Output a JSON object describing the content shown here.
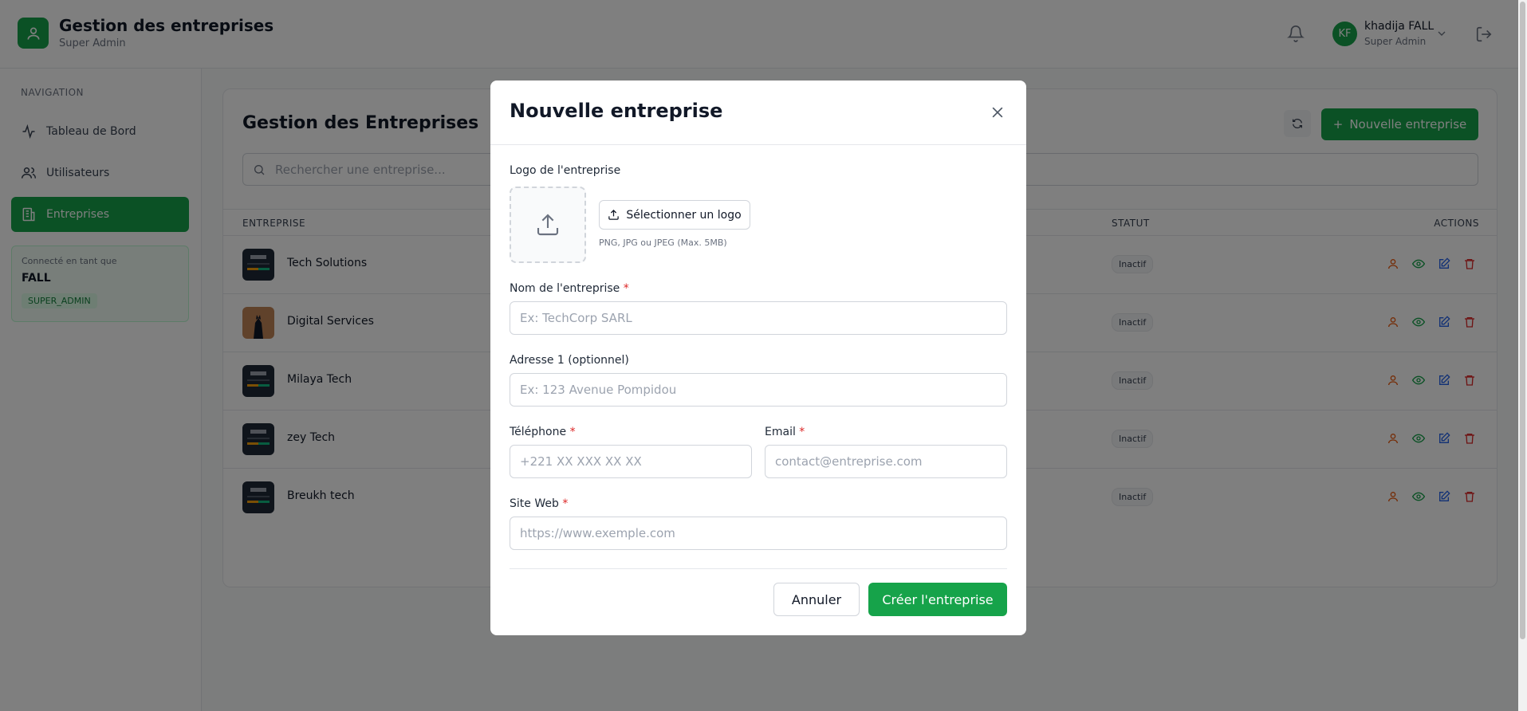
{
  "header": {
    "app_title": "Gestion des entreprises",
    "app_subtitle": "Super Admin",
    "user_initials": "KF",
    "user_name": "khadija FALL",
    "user_role": "Super Admin"
  },
  "sidebar": {
    "heading": "NAVIGATION",
    "items": [
      {
        "label": "Tableau de Bord",
        "icon": "activity-icon",
        "active": false
      },
      {
        "label": "Utilisateurs",
        "icon": "users-icon",
        "active": false
      },
      {
        "label": "Entreprises",
        "icon": "building-icon",
        "active": true
      }
    ],
    "connected_label": "Connecté en tant que",
    "connected_name": "FALL",
    "connected_badge": "SUPER_ADMIN"
  },
  "main": {
    "title": "Gestion des Entreprises",
    "new_button_label": "Nouvelle entreprise",
    "search_placeholder": "Rechercher une entreprise...",
    "columns": {
      "entreprise": "ENTREPRISE",
      "statut": "STATUT",
      "actions": "ACTIONS"
    },
    "rows": [
      {
        "name": "Tech Solutions",
        "status": "Inactif"
      },
      {
        "name": "Digital Services",
        "status": "Inactif"
      },
      {
        "name": "Milaya Tech",
        "status": "Inactif"
      },
      {
        "name": "zey Tech",
        "status": "Inactif"
      },
      {
        "name": "Breukh tech",
        "status": "Inactif"
      }
    ]
  },
  "modal": {
    "title": "Nouvelle entreprise",
    "logo_label": "Logo de l'entreprise",
    "logo_button": "Sélectionner un logo",
    "logo_hint": "PNG, JPG ou JPEG (Max. 5MB)",
    "name_label": "Nom de l'entreprise",
    "name_placeholder": "Ex: TechCorp SARL",
    "address_label": "Adresse 1 (optionnel)",
    "address_placeholder": "Ex: 123 Avenue Pompidou",
    "phone_label": "Téléphone",
    "phone_placeholder": "+221 XX XXX XX XX",
    "email_label": "Email",
    "email_placeholder": "contact@entreprise.com",
    "website_label": "Site Web",
    "website_placeholder": "https://www.exemple.com",
    "required_mark": "*",
    "cancel_label": "Annuler",
    "create_label": "Créer l'entreprise"
  },
  "colors": {
    "accent": "#16a34a",
    "overlay": "rgba(0,0,0,0.5)",
    "danger": "#dc2626"
  }
}
